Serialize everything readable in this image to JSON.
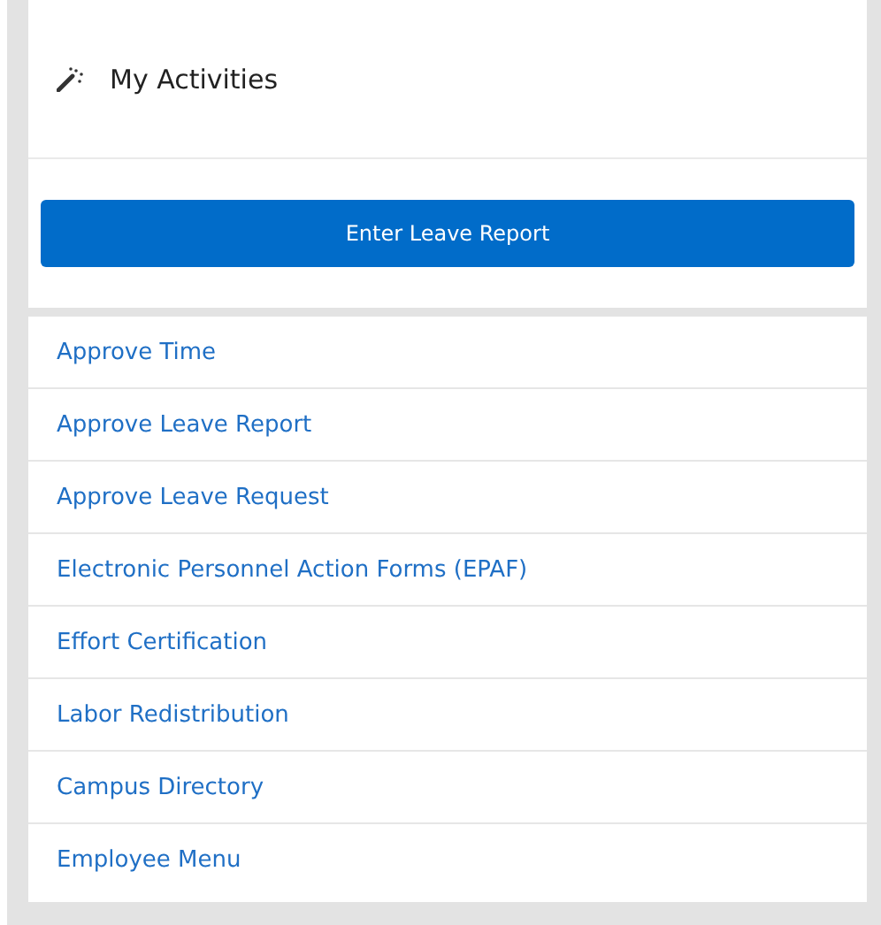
{
  "panel": {
    "title": "My Activities"
  },
  "primary_button": {
    "label": "Enter Leave Report"
  },
  "links": [
    {
      "label": "Approve Time"
    },
    {
      "label": "Approve Leave Report"
    },
    {
      "label": "Approve Leave Request"
    },
    {
      "label": "Electronic Personnel Action Forms (EPAF)"
    },
    {
      "label": "Effort Certification"
    },
    {
      "label": "Labor Redistribution"
    },
    {
      "label": "Campus Directory"
    },
    {
      "label": "Employee Menu"
    }
  ]
}
